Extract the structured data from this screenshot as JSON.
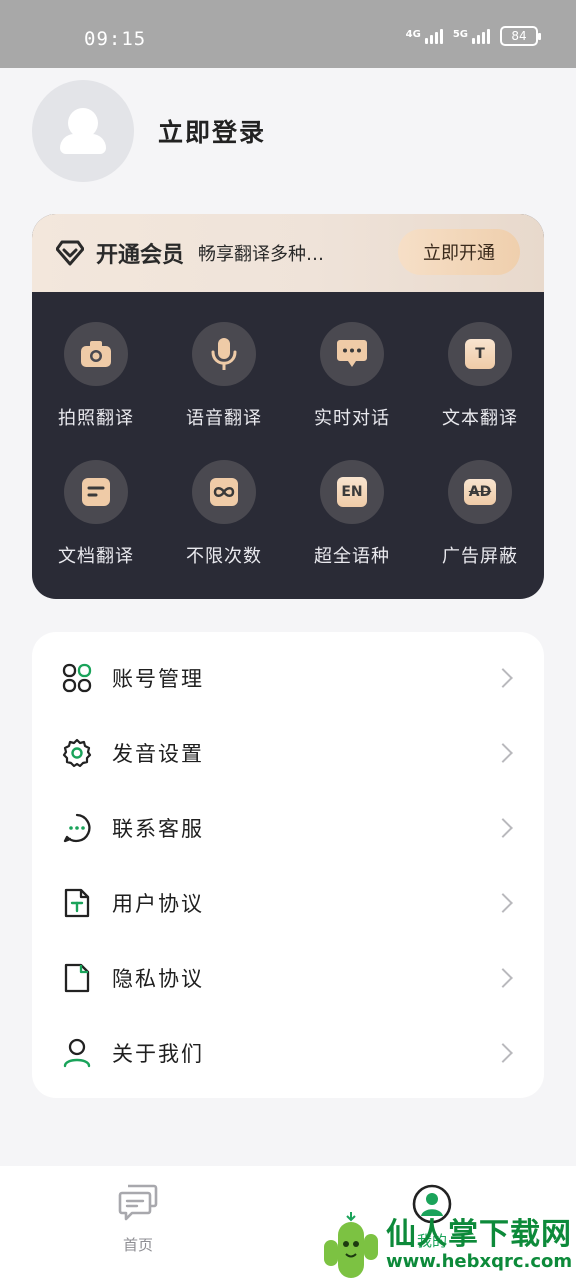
{
  "status_bar": {
    "time": "09:15",
    "network_1": "4G",
    "network_2": "5G",
    "battery": "84"
  },
  "profile": {
    "login_label": "立即登录"
  },
  "vip": {
    "title": "开通会员",
    "subtitle": "畅享翻译多种…",
    "button_label": "立即开通",
    "features": [
      {
        "label": "拍照翻译",
        "icon": "camera-icon"
      },
      {
        "label": "语音翻译",
        "icon": "microphone-icon"
      },
      {
        "label": "实时对话",
        "icon": "chat-bubble-icon"
      },
      {
        "label": "文本翻译",
        "icon": "text-icon"
      },
      {
        "label": "文档翻译",
        "icon": "document-icon"
      },
      {
        "label": "不限次数",
        "icon": "infinity-icon"
      },
      {
        "label": "超全语种",
        "icon": "language-en-icon"
      },
      {
        "label": "广告屏蔽",
        "icon": "ad-block-icon"
      }
    ],
    "icon_texts": {
      "text": "T",
      "en": "EN",
      "ad": "AD"
    },
    "accent_color": "#efcba7"
  },
  "settings": {
    "items": [
      {
        "label": "账号管理",
        "icon": "account-grid-icon"
      },
      {
        "label": "发音设置",
        "icon": "gear-icon"
      },
      {
        "label": "联系客服",
        "icon": "customer-service-icon"
      },
      {
        "label": "用户协议",
        "icon": "user-agreement-icon"
      },
      {
        "label": "隐私协议",
        "icon": "privacy-document-icon"
      },
      {
        "label": "关于我们",
        "icon": "person-icon"
      }
    ]
  },
  "tabbar": {
    "home_label": "首页",
    "mine_label": "我的",
    "active_color": "#1aa35a"
  },
  "watermark": {
    "title": "仙人掌下载网",
    "url": "www.hebxqrc.com"
  }
}
